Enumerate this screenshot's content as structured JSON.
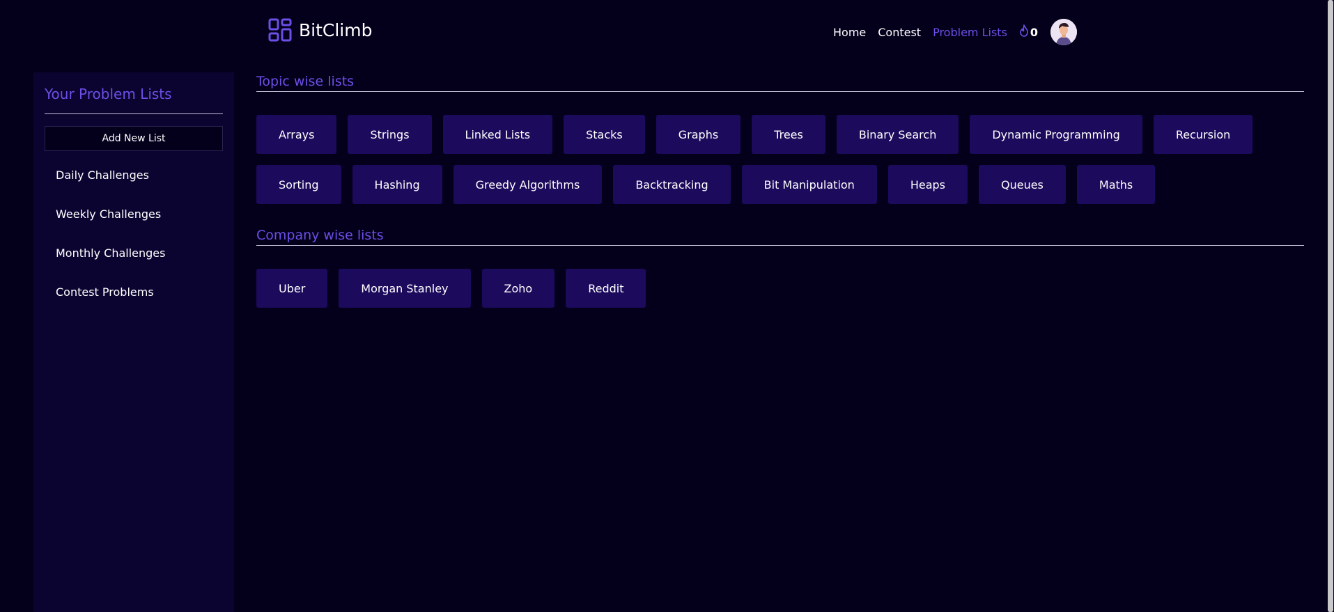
{
  "header": {
    "brand_name": "BitClimb",
    "nav": [
      {
        "label": "Home",
        "active": false
      },
      {
        "label": "Contest",
        "active": false
      },
      {
        "label": "Problem Lists",
        "active": true
      }
    ],
    "streak_count": "0",
    "accent_color": "#6c4fe6"
  },
  "sidebar": {
    "title": "Your Problem Lists",
    "add_button_label": "Add New List",
    "items": [
      {
        "label": "Daily Challenges"
      },
      {
        "label": "Weekly Challenges"
      },
      {
        "label": "Monthly Challenges"
      },
      {
        "label": "Contest Problems"
      }
    ]
  },
  "main": {
    "topic_section_title": "Topic wise lists",
    "topic_row1": [
      "Arrays",
      "Strings",
      "Linked Lists",
      "Stacks",
      "Graphs",
      "Trees",
      "Binary Search",
      "Dynamic Programming",
      "Recursion"
    ],
    "topic_row2": [
      "Sorting",
      "Hashing",
      "Greedy Algorithms",
      "Backtracking",
      "Bit Manipulation",
      "Heaps",
      "Queues",
      "Maths"
    ],
    "company_section_title": "Company wise lists",
    "company_row": [
      "Uber",
      "Morgan Stanley",
      "Zoho",
      "Reddit"
    ]
  },
  "icons": {
    "logo": "grid-logo-icon",
    "streak": "flame-icon",
    "avatar": "user-avatar"
  }
}
